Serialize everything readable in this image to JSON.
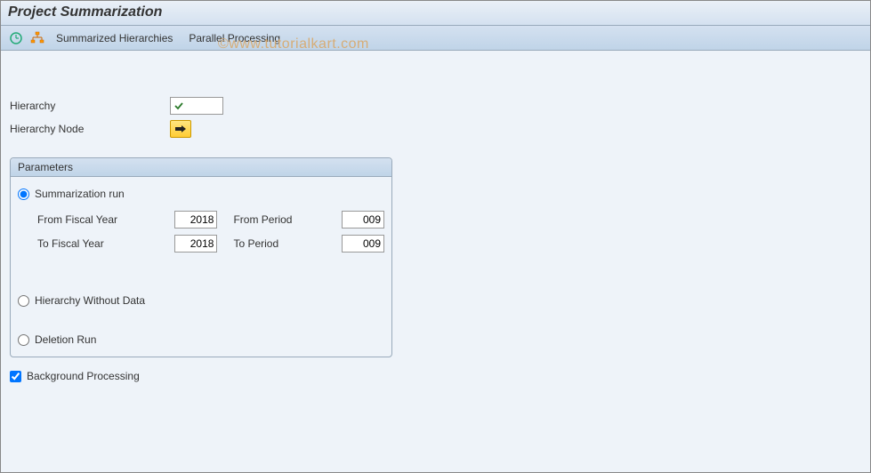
{
  "title": "Project Summarization",
  "watermark": "©www.tutorialkart.com",
  "toolbar": {
    "link1": "Summarized Hierarchies",
    "link2": "Parallel Processing"
  },
  "header": {
    "hierarchy_label": "Hierarchy",
    "hierarchy_node_label": "Hierarchy Node"
  },
  "params": {
    "group_title": "Parameters",
    "summarization_run_label": "Summarization run",
    "from_fiscal_year_label": "From Fiscal Year",
    "from_fiscal_year_value": "2018",
    "from_period_label": "From Period",
    "from_period_value": "009",
    "to_fiscal_year_label": "To Fiscal Year",
    "to_fiscal_year_value": "2018",
    "to_period_label": "To Period",
    "to_period_value": "009",
    "hierarchy_without_data_label": "Hierarchy Without Data",
    "deletion_run_label": "Deletion Run"
  },
  "background_processing_label": "Background Processing"
}
